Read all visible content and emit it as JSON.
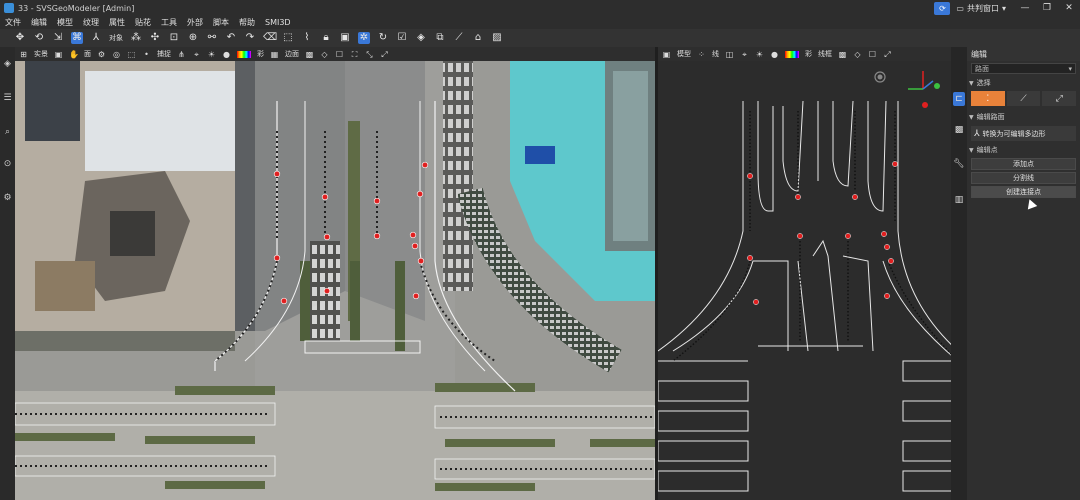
{
  "window": {
    "title": "33 - SVSGeoModeler [Admin]",
    "share_window_label": "共判窗口",
    "minimize": "—",
    "restore": "❐",
    "close": "✕"
  },
  "menu": [
    "文件",
    "编辑",
    "模型",
    "纹理",
    "属性",
    "贴花",
    "工具",
    "外部",
    "脚本",
    "帮助",
    "SMI3D"
  ],
  "toolbar": {
    "object_label": "对象",
    "icons": [
      "move-icon",
      "rotate-icon",
      "select-icon",
      "node-icon",
      "axis-icon",
      "object-icon",
      "group-icon",
      "transform-icon",
      "scale-icon",
      "pivot-icon",
      "link-icon",
      "undo-icon",
      "redo-icon",
      "erase-icon",
      "select-box-icon",
      "lasso-icon",
      "lock-icon",
      "cube-icon",
      "edit-poly-icon",
      "refresh-icon",
      "check-icon",
      "bucket-icon",
      "copy-icon",
      "ruler-icon",
      "building-icon",
      "image-icon"
    ]
  },
  "left_viewport_toolbar": {
    "mode_label": "实景",
    "face_label": "面",
    "snap_label": "捕捉",
    "color_label": "彩",
    "edge_label": "边面"
  },
  "right_viewport_toolbar": {
    "mode_label": "模型",
    "line_label": "线",
    "color_label": "彩",
    "wire_label": "线框"
  },
  "panel": {
    "title": "编辑",
    "dropdown_value": "路面",
    "section_select": "选择",
    "section_edit_road": "编辑路面",
    "convert_label": "转换为可编辑多边形",
    "section_edit_point": "编辑点",
    "add_point": "添加点",
    "split_line": "分割线",
    "create_connection": "创建连接点"
  },
  "colors": {
    "accent": "#3a78d8",
    "active_mode": "#e8823a",
    "control_point": "#e02020",
    "water": "#5ec8cc"
  }
}
